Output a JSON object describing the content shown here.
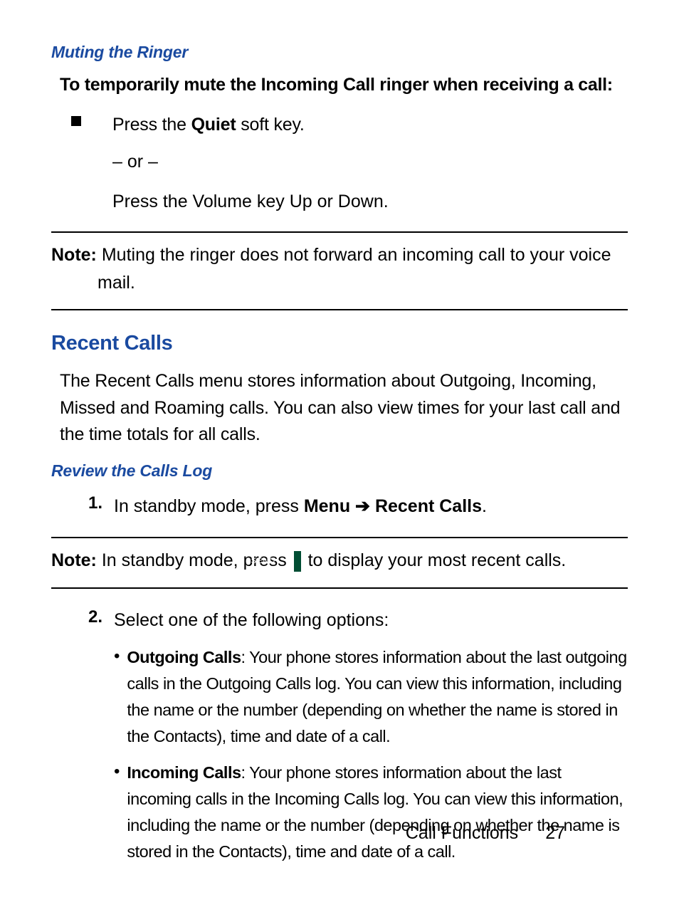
{
  "section1": {
    "subhead": "Muting the Ringer",
    "lead": "To temporarily mute the Incoming Call ringer when receiving a call:",
    "bullet": {
      "line1_pre": "Press the ",
      "line1_bold": "Quiet",
      "line1_post": " soft key.",
      "line2": "– or –",
      "line3": "Press the Volume key Up or Down."
    },
    "note_label": "Note:",
    "note_text": " Muting the ringer does not forward an incoming call to your voice mail."
  },
  "section2": {
    "head": "Recent Calls",
    "para": "The Recent Calls menu stores information about Outgoing, Incoming, Missed and Roaming calls. You can also view times for your last call and the time totals for all calls.",
    "subhead": "Review the Calls Log",
    "step1": {
      "num": "1.",
      "pre": "In standby mode, press ",
      "bold1": "Menu",
      "arrow": " ➔ ",
      "bold2": "Recent Calls",
      "post": "."
    },
    "note_label": "Note:",
    "note_pre": " In standby mode, press ",
    "send_label": "SEND",
    "note_post": " to display your most recent calls.",
    "step2": {
      "num": "2.",
      "text": "Select one of the following options:"
    },
    "opts": {
      "out_label": "Outgoing Calls",
      "out_text": ": Your phone stores information about the last outgoing calls in the Outgoing Calls log. You can view this information, including the name or the number (depending on whether the name is stored in the Contacts), time and date of a call.",
      "in_label": "Incoming Calls",
      "in_text": ": Your phone stores information about the last incoming calls in the Incoming Calls log. You can view this information, including the name or the number (depending on whether the name is stored in the Contacts), time and date of a call."
    }
  },
  "footer": {
    "chapter": "Call Functions",
    "page": "27"
  }
}
